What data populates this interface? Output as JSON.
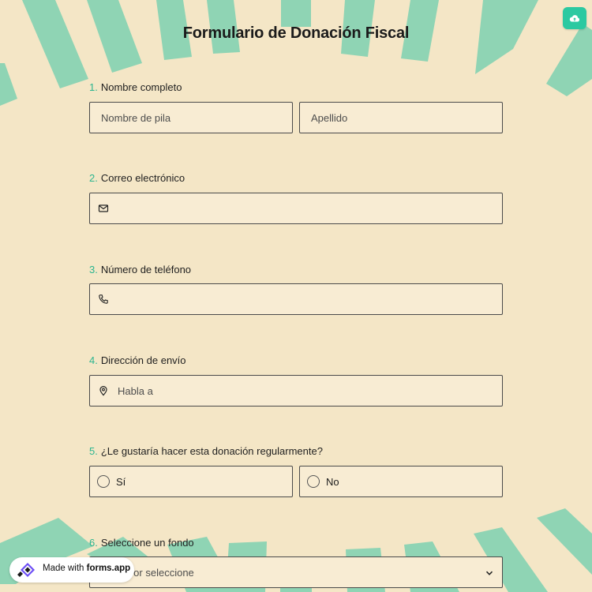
{
  "header": {
    "title": "Formulario de Donación Fiscal",
    "upload_icon": "cloud-upload-icon"
  },
  "questions": [
    {
      "num": "1.",
      "label": "Nombre completo",
      "fields": [
        {
          "placeholder": "Nombre de pila"
        },
        {
          "placeholder": "Apellido"
        }
      ]
    },
    {
      "num": "2.",
      "label": "Correo electrónico",
      "icon": "mail-icon",
      "placeholder": ""
    },
    {
      "num": "3.",
      "label": "Número de teléfono",
      "icon": "phone-icon",
      "placeholder": ""
    },
    {
      "num": "4.",
      "label": "Dirección de envío",
      "icon": "map-pin-icon",
      "placeholder": "Habla a"
    },
    {
      "num": "5.",
      "label": "¿Le gustaría hacer esta donación regularmente?",
      "options": [
        "Sí",
        "No"
      ]
    },
    {
      "num": "6.",
      "label": "Seleccione un fondo",
      "select_text": "Por favor seleccione",
      "icon": "chevron-down-icon"
    }
  ],
  "badge": {
    "prefix": "Made with ",
    "brand": "forms.app",
    "icon": "forms-app-logo-icon"
  },
  "colors": {
    "background": "#f4e6c6",
    "stripes": "#8fd4b4",
    "accent": "#2bc9a1",
    "field_bg": "#f8ecd3"
  }
}
